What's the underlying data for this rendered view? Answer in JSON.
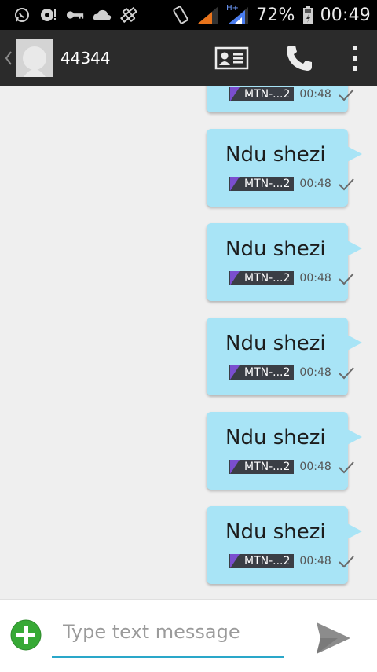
{
  "status_bar": {
    "battery_percent": "72%",
    "time": "00:49",
    "network_label": "H+"
  },
  "action_bar": {
    "title": "44344"
  },
  "messages": [
    {
      "text": "",
      "sim": "MTN-...2",
      "time": "00:48"
    },
    {
      "text": "Ndu shezi",
      "sim": "MTN-...2",
      "time": "00:48"
    },
    {
      "text": "Ndu shezi",
      "sim": "MTN-...2",
      "time": "00:48"
    },
    {
      "text": "Ndu shezi",
      "sim": "MTN-...2",
      "time": "00:48"
    },
    {
      "text": "Ndu shezi",
      "sim": "MTN-...2",
      "time": "00:48"
    },
    {
      "text": "Ndu shezi",
      "sim": "MTN-...2",
      "time": "00:48"
    }
  ],
  "composer": {
    "placeholder": "Type text message"
  },
  "colors": {
    "bubble": "#a8e4f6",
    "action_bar": "#2b2b2b",
    "accent": "#2aa7c9",
    "add_button": "#37a935"
  }
}
